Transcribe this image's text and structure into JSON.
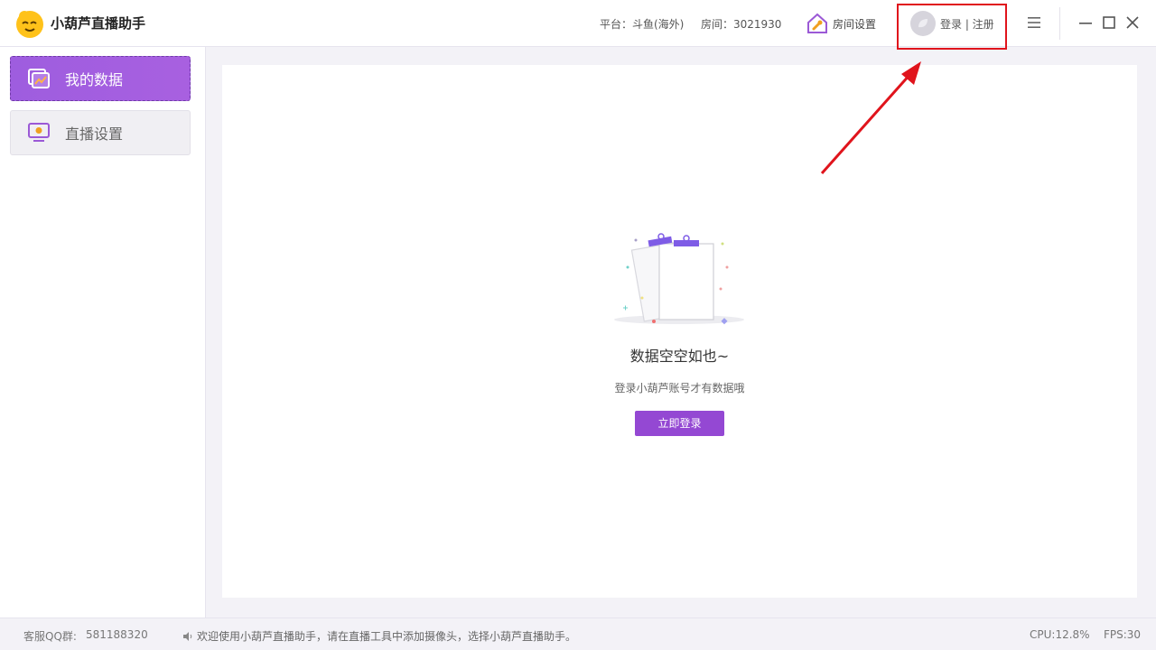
{
  "app": {
    "title": "小葫芦直播助手",
    "platform": "平台：斗鱼(海外)",
    "room": "房间：3021930",
    "room_settings_label": "房间设置",
    "login_register_label": "登录 | 注册"
  },
  "sidebar": {
    "items": [
      {
        "label": "我的数据",
        "icon": "chart-icon",
        "active": true
      },
      {
        "label": "直播设置",
        "icon": "monitor-icon",
        "active": false
      }
    ]
  },
  "main": {
    "empty_title": "数据空空如也~",
    "empty_subtitle": "登录小葫芦账号才有数据哦",
    "login_button_label": "立即登录"
  },
  "statusbar": {
    "qq_label": "客服QQ群:",
    "qq_number": "581188320",
    "notice": "欢迎使用小葫芦直播助手，请在直播工具中添加摄像头，选择小葫芦直播助手。",
    "cpu": "CPU:12.8%",
    "fps": "FPS:30"
  },
  "colors": {
    "accent": "#9e5ddf",
    "button": "#9448d3",
    "highlight": "#e0141c"
  }
}
